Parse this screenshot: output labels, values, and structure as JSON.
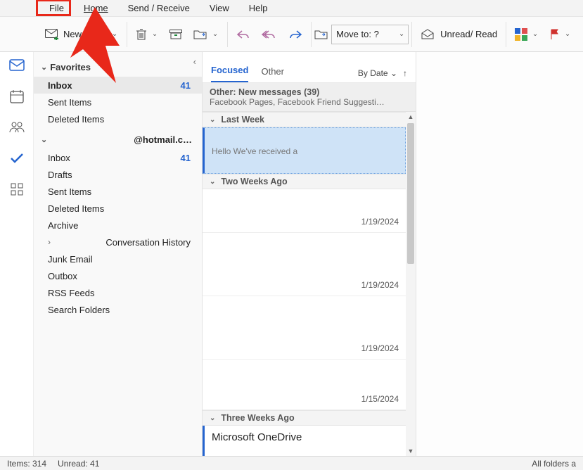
{
  "menu": {
    "file": "File",
    "home": "Home",
    "sendreceive": "Send / Receive",
    "view": "View",
    "help": "Help"
  },
  "ribbon": {
    "new_email": "New Email",
    "moveto_label": "Move to: ?",
    "unread_read": "Unread/ Read"
  },
  "favorites": {
    "header": "Favorites",
    "items": [
      {
        "label": "Inbox",
        "count": "41",
        "selected": true
      },
      {
        "label": "Sent Items"
      },
      {
        "label": "Deleted Items"
      }
    ]
  },
  "account": {
    "email": "@hotmail.c…",
    "folders": [
      {
        "label": "Inbox",
        "count": "41"
      },
      {
        "label": "Drafts"
      },
      {
        "label": "Sent Items"
      },
      {
        "label": "Deleted Items"
      },
      {
        "label": "Archive"
      },
      {
        "label": "Conversation History",
        "expandable": true
      },
      {
        "label": "Junk Email"
      },
      {
        "label": "Outbox"
      },
      {
        "label": "RSS Feeds"
      },
      {
        "label": "Search Folders"
      }
    ]
  },
  "listheader": {
    "tab_focused": "Focused",
    "tab_other": "Other",
    "sort_label": "By Date",
    "sort_caret": "⌄",
    "sort_dir": "↑"
  },
  "other_banner": {
    "title": "Other: New messages (39)",
    "sub": "Facebook Pages, Facebook Friend Suggesti…"
  },
  "groups": {
    "last_week": "Last Week",
    "two_weeks": "Two Weeks Ago",
    "three_weeks": "Three Weeks Ago"
  },
  "messages": {
    "last_week": [
      {
        "from": "",
        "preview": "Hello  We've received a",
        "selected": true
      }
    ],
    "two_weeks": [
      {
        "from": "",
        "preview": "",
        "date": "1/19/2024"
      },
      {
        "from": "",
        "preview": "",
        "date": "1/19/2024"
      },
      {
        "from": "",
        "preview": "",
        "date": "1/19/2024"
      },
      {
        "from": "",
        "preview": "",
        "date": "1/15/2024"
      }
    ],
    "three_weeks": [
      {
        "from": "Microsoft OneDrive",
        "preview": "",
        "unread": true
      }
    ]
  },
  "status": {
    "items": "Items: 314",
    "unread": "Unread: 41",
    "right": "All folders a"
  }
}
